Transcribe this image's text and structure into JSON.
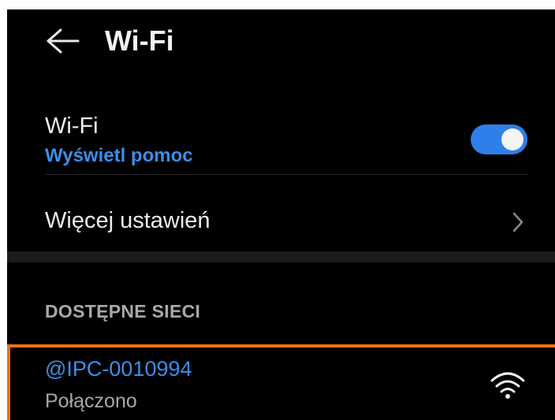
{
  "header": {
    "title": "Wi-Fi"
  },
  "wifi_toggle": {
    "label": "Wi-Fi",
    "help_link": "Wyświetl pomoc",
    "enabled": true,
    "accent_color": "#2e7fe9"
  },
  "more_settings": {
    "label": "Więcej ustawień"
  },
  "available_networks": {
    "section_title": "DOSTĘPNE SIECI",
    "items": [
      {
        "name": "@IPC-0010994",
        "status": "Połączono",
        "icon": "wifi-signal-icon"
      }
    ]
  },
  "colors": {
    "background": "#000000",
    "link": "#3a8ee8",
    "highlight_border": "#e8731a"
  }
}
